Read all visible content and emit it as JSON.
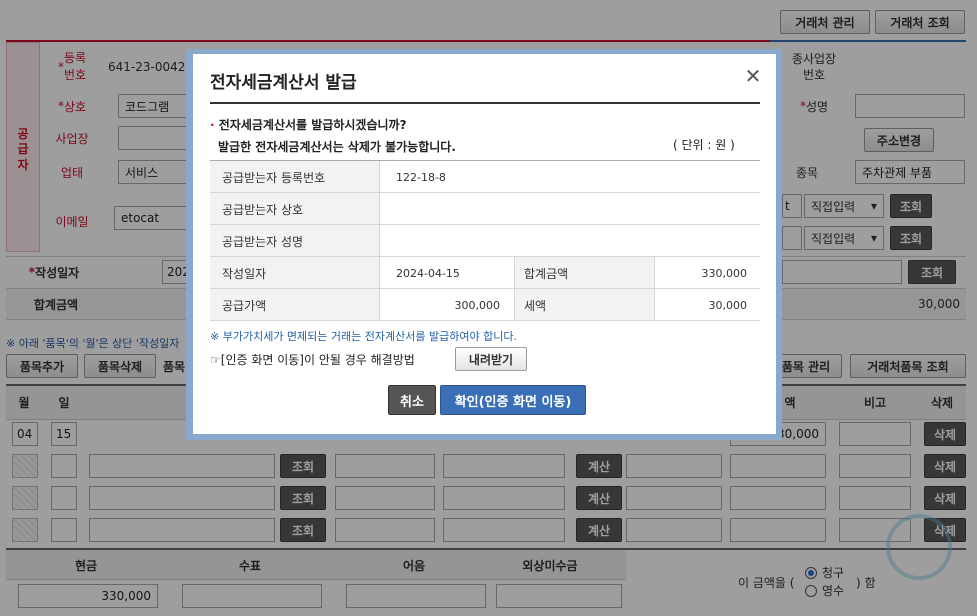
{
  "top_buttons": {
    "partner_manage": "거래처 관리",
    "partner_lookup": "거래처 조회"
  },
  "supplier": {
    "section_label": "공급자",
    "reg_no_label": "등록\n번호",
    "reg_no_value": "641-23-0042",
    "company_label": "상호",
    "company_value": "코드그램",
    "address_label": "사업장",
    "biz_type_label": "업태",
    "biz_type_value": "서비스",
    "email_label": "이메일",
    "email_value": "etocat"
  },
  "buyer": {
    "sub_biz_label": "종사업장\n번호",
    "name_label": "성명",
    "address_change_btn": "주소변경",
    "item_label": "종목",
    "item_value": "주차관제 부품",
    "direct_input_1": "직접입력",
    "direct_input_2": "직접입력",
    "lookup_btn": "조회",
    "email_partial": "t"
  },
  "write_date_label": "작성일자",
  "write_date_partial": "202",
  "total_label": "합계금액",
  "total_value_right": "30,000",
  "notice_left": "※ 아래 '품목'의 '월'은 상단 '작성일자",
  "item_buttons": {
    "add": "품목추가",
    "delete": "품목삭제",
    "item_partial": "품목",
    "item_manage": "품목 관리",
    "partner_item_lookup": "거래처품목 조회"
  },
  "items_header": {
    "month": "월",
    "day": "일",
    "amount_partial": "액",
    "note": "비고",
    "delete": "삭제"
  },
  "items_rows": [
    {
      "month": "04",
      "day": "15",
      "amount": "30,000",
      "lookup": "조회",
      "calc": "계산",
      "delete": "삭제"
    },
    {
      "month": "",
      "day": "",
      "amount": "",
      "lookup": "조회",
      "calc": "계산",
      "delete": "삭제"
    },
    {
      "month": "",
      "day": "",
      "amount": "",
      "lookup": "조회",
      "calc": "계산",
      "delete": "삭제"
    },
    {
      "month": "",
      "day": "",
      "amount": "",
      "lookup": "조회",
      "calc": "계산",
      "delete": "삭제"
    }
  ],
  "payment": {
    "cash_label": "현금",
    "check_label": "수표",
    "note_label": "어음",
    "credit_label": "외상미수금",
    "cash_value": "330,000",
    "claim_prefix": "이 금액을 (",
    "claim_suffix": ") 함",
    "opt_claim": "청구",
    "opt_receipt": "영수"
  },
  "modal": {
    "title": "전자세금계산서 발급",
    "question": "전자세금계산서를 발급하시겠습니까?",
    "warning": "발급한 전자세금계산서는 삭제가 불가능합니다.",
    "unit": "( 단위 : 원 )",
    "buyer_reg_label": "공급받는자 등록번호",
    "buyer_reg_value": "122-18-8",
    "buyer_company_label": "공급받는자 상호",
    "buyer_name_label": "공급받는자 성명",
    "date_label": "작성일자",
    "date_value": "2024-04-15",
    "total_label": "합계금액",
    "total_value": "330,000",
    "supply_label": "공급가액",
    "supply_value": "300,000",
    "tax_label": "세액",
    "tax_value": "30,000",
    "vat_notice": "※ 부가가치세가 면제되는 거래는 전자계산서를 발급하여야 합니다.",
    "cert_notice": "☞[인증 화면 이동]이 안될 경우 해결방법",
    "download_btn": "내려받기",
    "cancel_btn": "취소",
    "confirm_btn": "확인(인증 화면 이동)"
  },
  "colors": {
    "accent_blue": "#3a6fb5",
    "required_red": "#c8102e",
    "modal_frame": "#8aa8cc"
  }
}
